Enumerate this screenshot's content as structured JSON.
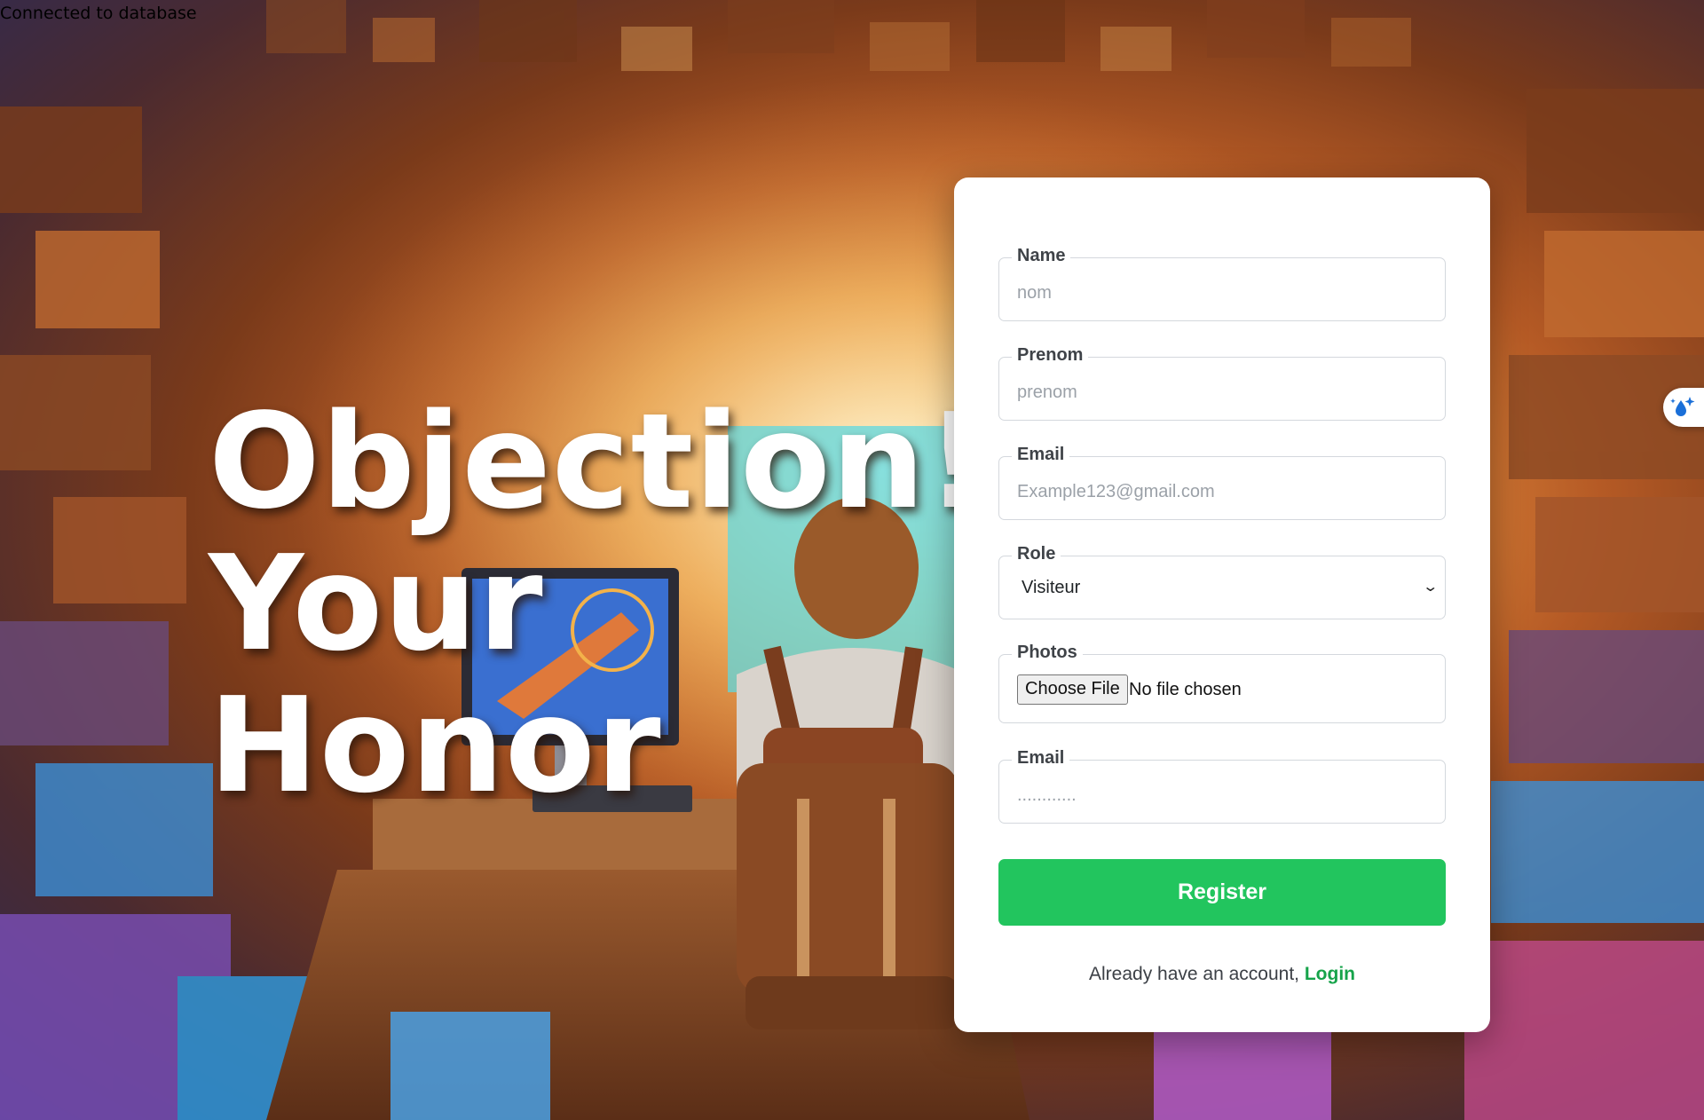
{
  "status": {
    "db_message": "Connected to database"
  },
  "hero": {
    "line1": "Objection!",
    "line2": "Your",
    "line3": "Honor"
  },
  "form": {
    "name": {
      "label": "Name",
      "placeholder": "nom",
      "value": ""
    },
    "prenom": {
      "label": "Prenom",
      "placeholder": "prenom",
      "value": ""
    },
    "email": {
      "label": "Email",
      "placeholder": "Example123@gmail.com",
      "value": ""
    },
    "role": {
      "label": "Role",
      "selected": "Visiteur"
    },
    "photos": {
      "label": "Photos",
      "button_label": "Choose File",
      "status": "No file chosen"
    },
    "password": {
      "label": "Email",
      "placeholder": "............",
      "value": ""
    },
    "register_label": "Register",
    "login_prompt": "Already have an account,",
    "login_link": "Login"
  },
  "colors": {
    "accent": "#22c55e",
    "link": "#16a34a",
    "card_bg": "#ffffff"
  },
  "icons": {
    "extension_widget": "sparkle-drop-icon"
  }
}
